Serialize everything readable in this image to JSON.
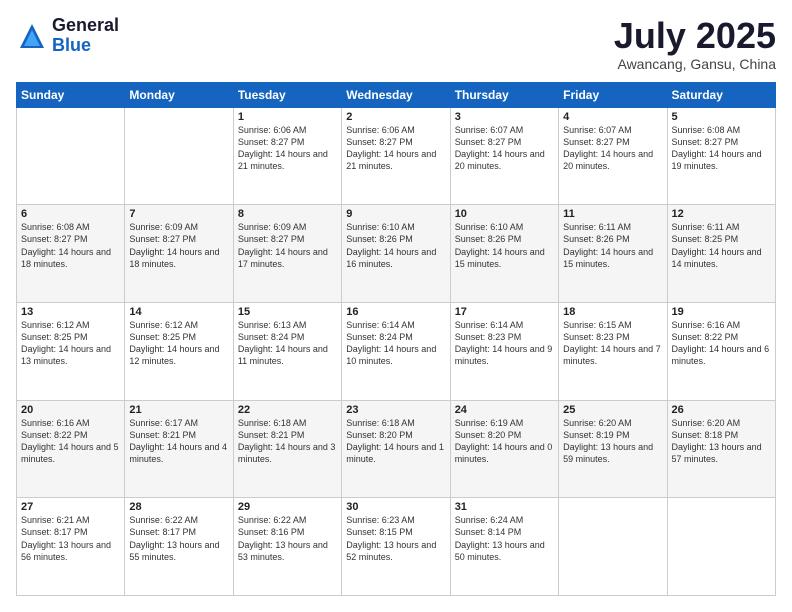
{
  "header": {
    "logo_general": "General",
    "logo_blue": "Blue",
    "month_title": "July 2025",
    "location": "Awancang, Gansu, China"
  },
  "weekdays": [
    "Sunday",
    "Monday",
    "Tuesday",
    "Wednesday",
    "Thursday",
    "Friday",
    "Saturday"
  ],
  "weeks": [
    [
      {
        "day": "",
        "info": ""
      },
      {
        "day": "",
        "info": ""
      },
      {
        "day": "1",
        "info": "Sunrise: 6:06 AM\nSunset: 8:27 PM\nDaylight: 14 hours and 21 minutes."
      },
      {
        "day": "2",
        "info": "Sunrise: 6:06 AM\nSunset: 8:27 PM\nDaylight: 14 hours and 21 minutes."
      },
      {
        "day": "3",
        "info": "Sunrise: 6:07 AM\nSunset: 8:27 PM\nDaylight: 14 hours and 20 minutes."
      },
      {
        "day": "4",
        "info": "Sunrise: 6:07 AM\nSunset: 8:27 PM\nDaylight: 14 hours and 20 minutes."
      },
      {
        "day": "5",
        "info": "Sunrise: 6:08 AM\nSunset: 8:27 PM\nDaylight: 14 hours and 19 minutes."
      }
    ],
    [
      {
        "day": "6",
        "info": "Sunrise: 6:08 AM\nSunset: 8:27 PM\nDaylight: 14 hours and 18 minutes."
      },
      {
        "day": "7",
        "info": "Sunrise: 6:09 AM\nSunset: 8:27 PM\nDaylight: 14 hours and 18 minutes."
      },
      {
        "day": "8",
        "info": "Sunrise: 6:09 AM\nSunset: 8:27 PM\nDaylight: 14 hours and 17 minutes."
      },
      {
        "day": "9",
        "info": "Sunrise: 6:10 AM\nSunset: 8:26 PM\nDaylight: 14 hours and 16 minutes."
      },
      {
        "day": "10",
        "info": "Sunrise: 6:10 AM\nSunset: 8:26 PM\nDaylight: 14 hours and 15 minutes."
      },
      {
        "day": "11",
        "info": "Sunrise: 6:11 AM\nSunset: 8:26 PM\nDaylight: 14 hours and 15 minutes."
      },
      {
        "day": "12",
        "info": "Sunrise: 6:11 AM\nSunset: 8:25 PM\nDaylight: 14 hours and 14 minutes."
      }
    ],
    [
      {
        "day": "13",
        "info": "Sunrise: 6:12 AM\nSunset: 8:25 PM\nDaylight: 14 hours and 13 minutes."
      },
      {
        "day": "14",
        "info": "Sunrise: 6:12 AM\nSunset: 8:25 PM\nDaylight: 14 hours and 12 minutes."
      },
      {
        "day": "15",
        "info": "Sunrise: 6:13 AM\nSunset: 8:24 PM\nDaylight: 14 hours and 11 minutes."
      },
      {
        "day": "16",
        "info": "Sunrise: 6:14 AM\nSunset: 8:24 PM\nDaylight: 14 hours and 10 minutes."
      },
      {
        "day": "17",
        "info": "Sunrise: 6:14 AM\nSunset: 8:23 PM\nDaylight: 14 hours and 9 minutes."
      },
      {
        "day": "18",
        "info": "Sunrise: 6:15 AM\nSunset: 8:23 PM\nDaylight: 14 hours and 7 minutes."
      },
      {
        "day": "19",
        "info": "Sunrise: 6:16 AM\nSunset: 8:22 PM\nDaylight: 14 hours and 6 minutes."
      }
    ],
    [
      {
        "day": "20",
        "info": "Sunrise: 6:16 AM\nSunset: 8:22 PM\nDaylight: 14 hours and 5 minutes."
      },
      {
        "day": "21",
        "info": "Sunrise: 6:17 AM\nSunset: 8:21 PM\nDaylight: 14 hours and 4 minutes."
      },
      {
        "day": "22",
        "info": "Sunrise: 6:18 AM\nSunset: 8:21 PM\nDaylight: 14 hours and 3 minutes."
      },
      {
        "day": "23",
        "info": "Sunrise: 6:18 AM\nSunset: 8:20 PM\nDaylight: 14 hours and 1 minute."
      },
      {
        "day": "24",
        "info": "Sunrise: 6:19 AM\nSunset: 8:20 PM\nDaylight: 14 hours and 0 minutes."
      },
      {
        "day": "25",
        "info": "Sunrise: 6:20 AM\nSunset: 8:19 PM\nDaylight: 13 hours and 59 minutes."
      },
      {
        "day": "26",
        "info": "Sunrise: 6:20 AM\nSunset: 8:18 PM\nDaylight: 13 hours and 57 minutes."
      }
    ],
    [
      {
        "day": "27",
        "info": "Sunrise: 6:21 AM\nSunset: 8:17 PM\nDaylight: 13 hours and 56 minutes."
      },
      {
        "day": "28",
        "info": "Sunrise: 6:22 AM\nSunset: 8:17 PM\nDaylight: 13 hours and 55 minutes."
      },
      {
        "day": "29",
        "info": "Sunrise: 6:22 AM\nSunset: 8:16 PM\nDaylight: 13 hours and 53 minutes."
      },
      {
        "day": "30",
        "info": "Sunrise: 6:23 AM\nSunset: 8:15 PM\nDaylight: 13 hours and 52 minutes."
      },
      {
        "day": "31",
        "info": "Sunrise: 6:24 AM\nSunset: 8:14 PM\nDaylight: 13 hours and 50 minutes."
      },
      {
        "day": "",
        "info": ""
      },
      {
        "day": "",
        "info": ""
      }
    ]
  ]
}
